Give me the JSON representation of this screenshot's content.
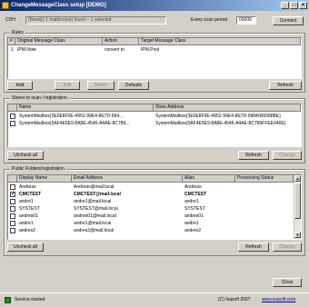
{
  "window": {
    "title": "ChangeMessageClass setup [DEMO]"
  },
  "top": {
    "conn_label": "CDH",
    "conn_value": "(Ready) 1 mailbox(es) found – 1 selected",
    "interval_label": "Every scan period",
    "interval_value": "00000",
    "connect_button": "Connect"
  },
  "rules": {
    "group_title": "Rules",
    "headers": [
      "#",
      "Original Message Class",
      "Action",
      "Target Message Class"
    ],
    "rows": [
      {
        "num": "1",
        "orig": "IPM.Note",
        "action": "convert to",
        "target": "IPM.Post"
      }
    ],
    "buttons": {
      "add": "Add",
      "edit": "Edit",
      "delete": "Delete",
      "defaults": "Defaults",
      "refresh": "Refresh"
    }
  },
  "stores": {
    "group_title": "Stores to scan / registration",
    "headers": [
      "Name",
      "Store Address"
    ],
    "rows": [
      {
        "name": "SystemMailbox{3E0E8F0E-4952-99E4-8E7D-994...",
        "addr": "SystemMailbox{3E0E8F0E-4952-99E4-8E7D-9984000088BE}"
      },
      {
        "name": "SystemMailbox{5AF4E5E9-8A8E-4546-A4AE-8C789...",
        "addr": "SystemMailbox{5AF4E5E9-8A8E-4546-A4AE-8C789FFEE046E}"
      }
    ],
    "buttons": {
      "uncheck": "Uncheck all",
      "refresh": "Refresh",
      "change": "Change"
    }
  },
  "mailboxes": {
    "group_title": "Public Folders/registration",
    "headers": [
      "Display Name",
      "Email Address",
      "Alias",
      "Processing Status"
    ],
    "rows": [
      {
        "checked": false,
        "name": "Andreas",
        "email": "Andreas@mail.local",
        "alias": "Andreas"
      },
      {
        "checked": true,
        "name": "CMCTEST",
        "email": "CMCTEST@mail.local",
        "alias": "CMCTEST"
      },
      {
        "checked": false,
        "name": "andre1",
        "email": "andre1@mail.local",
        "alias": "andre1"
      },
      {
        "checked": false,
        "name": "SYSTEST",
        "email": "SYSTEST@mail.local",
        "alias": "SYSTEST"
      },
      {
        "checked": false,
        "name": "andres01",
        "email": "andres01@mail.local",
        "alias": "andres01"
      },
      {
        "checked": false,
        "name": "andre1",
        "email": "andre1@mail.local",
        "alias": "andre1"
      },
      {
        "checked": false,
        "name": "andres2",
        "email": "andres2@mail.local",
        "alias": "andres2"
      }
    ],
    "buttons": {
      "uncheck": "Uncheck all",
      "refresh": "Refresh",
      "change": "Change"
    }
  },
  "status": {
    "text": "Service started",
    "copyright": "(C) Ivasoft 2007",
    "url": "www.ivasoft.com",
    "close_button": "Close",
    "led_color": "#1c8a1c"
  }
}
